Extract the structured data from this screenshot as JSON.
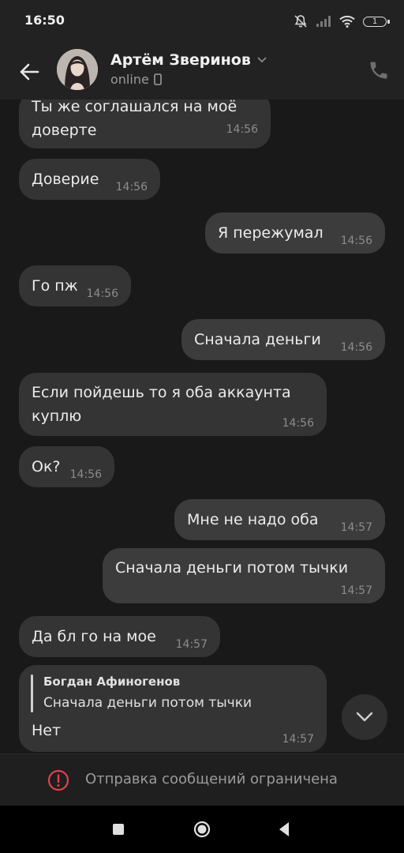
{
  "status_bar": {
    "time": "16:50",
    "battery": "1"
  },
  "header": {
    "name": "Артём Зверинов",
    "status": "online"
  },
  "messages": [
    {
      "text": "Ты же соглашался на моё\nдоверте",
      "time": "14:56",
      "dir": "in"
    },
    {
      "text": "Доверие",
      "time": "14:56",
      "dir": "in"
    },
    {
      "text": "Я пережумал",
      "time": "14:56",
      "dir": "out"
    },
    {
      "text": "Го пж",
      "time": "14:56",
      "dir": "in"
    },
    {
      "text": "Сначала деньги",
      "time": "14:56",
      "dir": "out"
    },
    {
      "text": "Если пойдешь то я оба аккаунта\nкуплю",
      "time": "14:56",
      "dir": "in"
    },
    {
      "text": "Ок?",
      "time": "14:56",
      "dir": "in"
    },
    {
      "text": "Мне не надо оба",
      "time": "14:57",
      "dir": "out"
    },
    {
      "text": "Сначала деньги потом тычки",
      "time": "14:57",
      "dir": "out"
    },
    {
      "text": "Да бл го на мое",
      "time": "14:57",
      "dir": "in"
    },
    {
      "reply_author": "Богдан Афиногенов",
      "reply_text": "Сначала деньги потом тычки",
      "text": "Нет",
      "time": "14:57",
      "dir": "in"
    }
  ],
  "footer": {
    "restriction_text": "Отправка сообщений ограничена"
  }
}
